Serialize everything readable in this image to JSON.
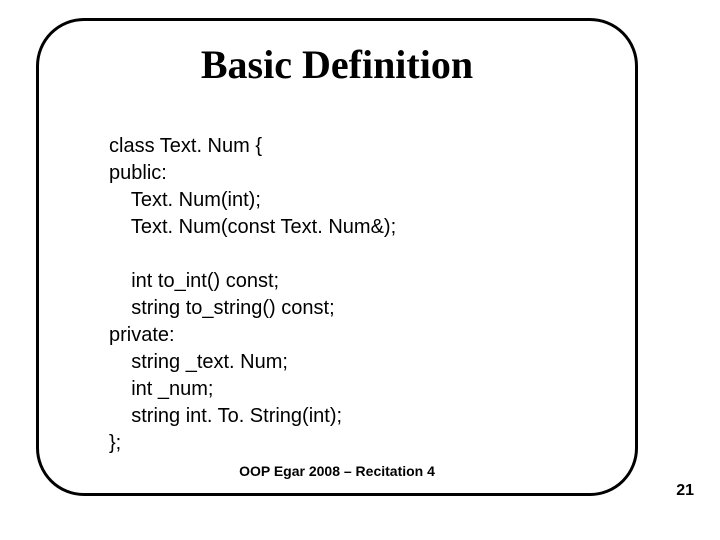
{
  "title": "Basic Definition",
  "code": {
    "l01": "class Text. Num {",
    "l02": "public:",
    "l03": "    Text. Num(int);",
    "l04": "    Text. Num(const Text. Num&);",
    "l05": "",
    "l06": "    int to_int() const;",
    "l07": "    string to_string() const;",
    "l08": "private:",
    "l09": "    string _text. Num;",
    "l10": "    int _num;",
    "l11": "    string int. To. String(int);",
    "l12": "};"
  },
  "footer": "OOP Egar 2008 – Recitation 4",
  "page_number": "21"
}
